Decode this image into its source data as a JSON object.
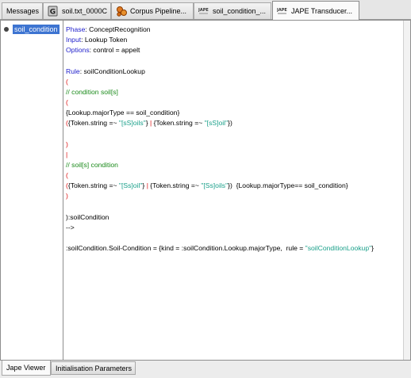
{
  "tabs": [
    {
      "label": "Messages",
      "icon": "none"
    },
    {
      "label": "soil.txt_0000C",
      "icon": "document-g-icon"
    },
    {
      "label": "Corpus Pipeline...",
      "icon": "gear-cluster-icon"
    },
    {
      "label": "soil_condition_...",
      "icon": "jape-icon"
    },
    {
      "label": "JAPE Transducer...",
      "icon": "jape-icon"
    }
  ],
  "tree": {
    "selected_item": "soil_condition"
  },
  "editor": {
    "lines": [
      [
        {
          "t": "Phase",
          "c": "kw"
        },
        {
          "t": ": ConceptRecognition",
          "c": "pl"
        }
      ],
      [
        {
          "t": "Input",
          "c": "kw"
        },
        {
          "t": ": Lookup Token",
          "c": "pl"
        }
      ],
      [
        {
          "t": "Options",
          "c": "kw"
        },
        {
          "t": ": control = appelt",
          "c": "pl"
        }
      ],
      [],
      [
        {
          "t": "Rule",
          "c": "kw"
        },
        {
          "t": ": soilConditionLookup",
          "c": "pl"
        }
      ],
      [
        {
          "t": "(",
          "c": "br"
        }
      ],
      [
        {
          "t": "// condition soil[s]",
          "c": "cm"
        }
      ],
      [
        {
          "t": "(",
          "c": "br"
        }
      ],
      [
        {
          "t": "{Lookup.majorType == soil_condition}",
          "c": "pl"
        }
      ],
      [
        {
          "t": "(",
          "c": "br"
        },
        {
          "t": "{Token.string =~ ",
          "c": "pl"
        },
        {
          "t": "\"[sS]oils\"",
          "c": "st"
        },
        {
          "t": "} ",
          "c": "pl"
        },
        {
          "t": "|",
          "c": "br"
        },
        {
          "t": " {Token.string =~ ",
          "c": "pl"
        },
        {
          "t": "\"[sS]oil\"",
          "c": "st"
        },
        {
          "t": "})",
          "c": "pl"
        }
      ],
      [],
      [
        {
          "t": ")",
          "c": "br"
        }
      ],
      [
        {
          "t": "|",
          "c": "br"
        }
      ],
      [
        {
          "t": "// soil[s] condition",
          "c": "cm"
        }
      ],
      [
        {
          "t": "(",
          "c": "br"
        }
      ],
      [
        {
          "t": "(",
          "c": "br"
        },
        {
          "t": "{Token.string =~ ",
          "c": "pl"
        },
        {
          "t": "\"[Ss]oil\"",
          "c": "st"
        },
        {
          "t": "} ",
          "c": "pl"
        },
        {
          "t": "|",
          "c": "br"
        },
        {
          "t": " {Token.string =~ ",
          "c": "pl"
        },
        {
          "t": "\"[Ss]oils\"",
          "c": "st"
        },
        {
          "t": "})  {Lookup.majorType== soil_condition}",
          "c": "pl"
        }
      ],
      [
        {
          "t": ")",
          "c": "br"
        }
      ],
      [],
      [
        {
          "t": "):soilCondition",
          "c": "pl"
        }
      ],
      [
        {
          "t": "-->",
          "c": "pl"
        }
      ],
      [],
      [
        {
          "t": ":soilCondition.Soil-Condition = {kind = :soilCondition.Lookup.majorType,  rule = ",
          "c": "pl"
        },
        {
          "t": "\"soilConditionLookup\"",
          "c": "st"
        },
        {
          "t": "}",
          "c": "pl"
        }
      ]
    ]
  },
  "bottom_tabs": [
    {
      "label": "Jape Viewer"
    },
    {
      "label": "Initialisation Parameters"
    }
  ]
}
